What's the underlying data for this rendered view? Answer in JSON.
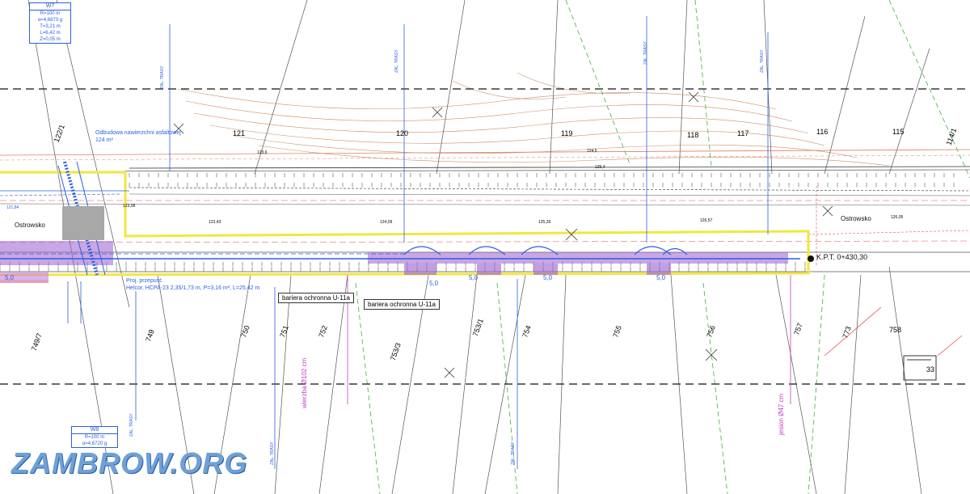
{
  "curves": {
    "w7": {
      "title": "W7",
      "lines": [
        "R=100 m",
        "α=4,6873 g",
        "T=3,21 m",
        "L=6,42 m",
        "Z=0,05 m"
      ]
    },
    "w8": {
      "title": "W8",
      "lines": [
        "R=100 m",
        "α=4,6720 g"
      ]
    }
  },
  "labels": {
    "odbudowa": [
      "Odbudowa nawierzchni asfaltowej",
      "124 m²"
    ],
    "przepust": [
      "Proj. przepust:",
      "Helcor, HCPA-23 2,35/1,73 m, P=3,16 m², L=25,42 m"
    ],
    "bariera1": "bariera ochronna U-11a",
    "bariera2": "bariera ochronna U-11a",
    "ostrowsko_left": "Ostrowsko",
    "ostrowsko_right": "Ostrowsko",
    "kpt": "K.P.T. 0+430,30",
    "wierzba": "wierzba Ø102 cm",
    "jesion": "jesion Ø47 cm",
    "zal": "ZAL. TRASY"
  },
  "dims": [
    "5,0",
    "5,0",
    "5,0",
    "5,0",
    "5,0"
  ],
  "parcels": [
    "122/1",
    "121",
    "120",
    "119",
    "118",
    "117",
    "116",
    "115",
    "114/1",
    "749/7",
    "749",
    "750",
    "751",
    "752",
    "753/1",
    "753/3",
    "754",
    "755",
    "756",
    "757",
    "773",
    "758",
    "33"
  ],
  "elev": [
    "123,43",
    "124,09",
    "125,26",
    "126,57",
    "123,08",
    "123,6",
    "124,5",
    "125,4",
    "126,05",
    "121,84"
  ],
  "watermark": "ZAMBROW.ORG",
  "colors": {
    "road_edge": "#f2e640",
    "purple": "#9a5fd0",
    "blue": "#2d5fe0",
    "red": "#e05050",
    "green": "#40b040",
    "magenta": "#c040c0"
  }
}
